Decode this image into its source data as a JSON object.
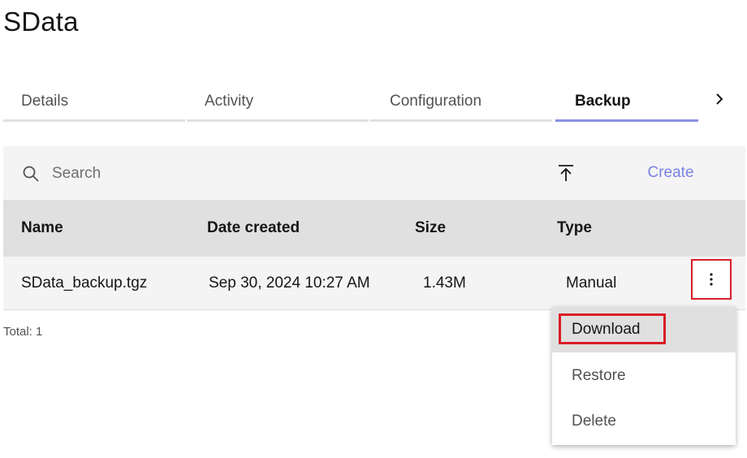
{
  "page": {
    "title": "SData"
  },
  "tabs": [
    {
      "label": "Details"
    },
    {
      "label": "Activity"
    },
    {
      "label": "Configuration"
    },
    {
      "label": "Backup",
      "active": true
    }
  ],
  "toolbar": {
    "search_placeholder": "Search",
    "create_label": "Create"
  },
  "table": {
    "columns": [
      "Name",
      "Date created",
      "Size",
      "Type"
    ],
    "rows": [
      {
        "name": "SData_backup.tgz",
        "date_created": "Sep 30, 2024 10:27 AM",
        "size": "1.43M",
        "type": "Manual"
      }
    ],
    "total": "Total: 1"
  },
  "menu": {
    "items": [
      "Download",
      "Restore",
      "Delete"
    ]
  },
  "colors": {
    "accent": "#7b82e6",
    "highlight": "#da1e28",
    "tab_active": "#8a8fe6"
  },
  "icons": {
    "search": "search-icon",
    "upload": "upload-icon",
    "overflow": "overflow-menu-icon",
    "tab_scroll": "chevron-right-icon"
  }
}
